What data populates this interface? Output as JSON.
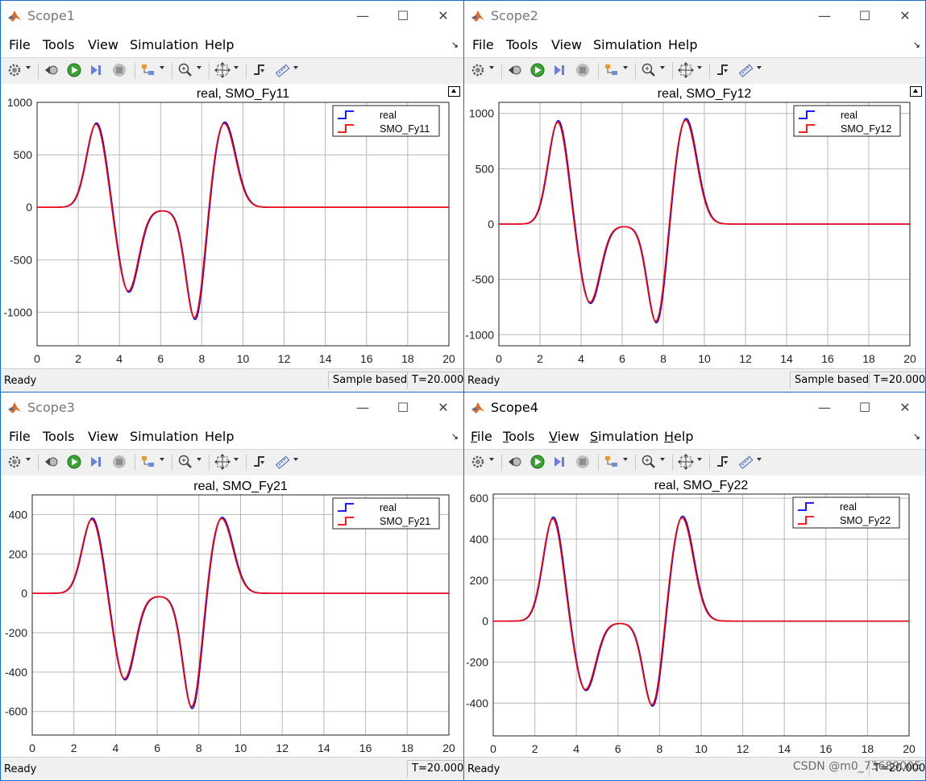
{
  "menu": [
    "File",
    "Tools",
    "View",
    "Simulation",
    "Help"
  ],
  "status": {
    "ready": "Ready",
    "mode": "Sample based",
    "time": "T=20.000"
  },
  "legend_style": {
    "real_color": "#0000ff",
    "smo_color": "#ff0000"
  },
  "windows": [
    {
      "title": "Scope1",
      "active": false,
      "show_mode": true,
      "chart_data": {
        "type": "line",
        "title": "real, SMO_Fy11",
        "xlim": [
          0,
          20
        ],
        "ylim": [
          -1320,
          1000
        ],
        "xticks": [
          0,
          2,
          4,
          6,
          8,
          10,
          12,
          14,
          16,
          18,
          20
        ],
        "yticks": [
          1000,
          500,
          0,
          -500,
          -1000
        ],
        "grid": true,
        "legend_position": "top-right",
        "peaks": {
          "p1": 810,
          "v1": -810,
          "p2": -30,
          "v2": -1090,
          "p3": 820
        },
        "series": [
          {
            "name": "real",
            "color": "#0000ff"
          },
          {
            "name": "SMO_Fy11",
            "color": "#ff0000"
          }
        ]
      }
    },
    {
      "title": "Scope2",
      "active": false,
      "show_mode": true,
      "chart_data": {
        "type": "line",
        "title": "real, SMO_Fy12",
        "xlim": [
          0,
          20
        ],
        "ylim": [
          -1100,
          1100
        ],
        "xticks": [
          0,
          2,
          4,
          6,
          8,
          10,
          12,
          14,
          16,
          18,
          20
        ],
        "yticks": [
          1000,
          500,
          0,
          -500,
          -1000
        ],
        "grid": true,
        "legend_position": "top-right",
        "peaks": {
          "p1": 940,
          "v1": -720,
          "p2": -20,
          "v2": -920,
          "p3": 960
        },
        "series": [
          {
            "name": "real",
            "color": "#0000ff"
          },
          {
            "name": "SMO_Fy12",
            "color": "#ff0000"
          }
        ]
      }
    },
    {
      "title": "Scope3",
      "active": false,
      "show_mode": false,
      "chart_data": {
        "type": "line",
        "title": "real, SMO_Fy21",
        "xlim": [
          0,
          20
        ],
        "ylim": [
          -720,
          500
        ],
        "xticks": [
          0,
          2,
          4,
          6,
          8,
          10,
          12,
          14,
          16,
          18,
          20
        ],
        "yticks": [
          400,
          200,
          0,
          -200,
          -400,
          -600
        ],
        "grid": true,
        "legend_position": "top-right",
        "peaks": {
          "p1": 385,
          "v1": -440,
          "p2": -15,
          "v2": -595,
          "p3": 390
        },
        "series": [
          {
            "name": "real",
            "color": "#0000ff"
          },
          {
            "name": "SMO_Fy21",
            "color": "#ff0000"
          }
        ]
      }
    },
    {
      "title": "Scope4",
      "active": true,
      "show_mode": false,
      "chart_data": {
        "type": "line",
        "title": "real, SMO_Fy22",
        "xlim": [
          0,
          20
        ],
        "ylim": [
          -560,
          620
        ],
        "xticks": [
          0,
          2,
          4,
          6,
          8,
          10,
          12,
          14,
          16,
          18,
          20
        ],
        "yticks": [
          600,
          400,
          200,
          0,
          -200,
          -400
        ],
        "grid": true,
        "legend_position": "top-right",
        "peaks": {
          "p1": 510,
          "v1": -340,
          "p2": -10,
          "v2": -430,
          "p3": 515
        },
        "series": [
          {
            "name": "real",
            "color": "#0000ff"
          },
          {
            "name": "SMO_Fy22",
            "color": "#ff0000"
          }
        ]
      }
    }
  ],
  "watermark": "CSDN @m0_73689005"
}
